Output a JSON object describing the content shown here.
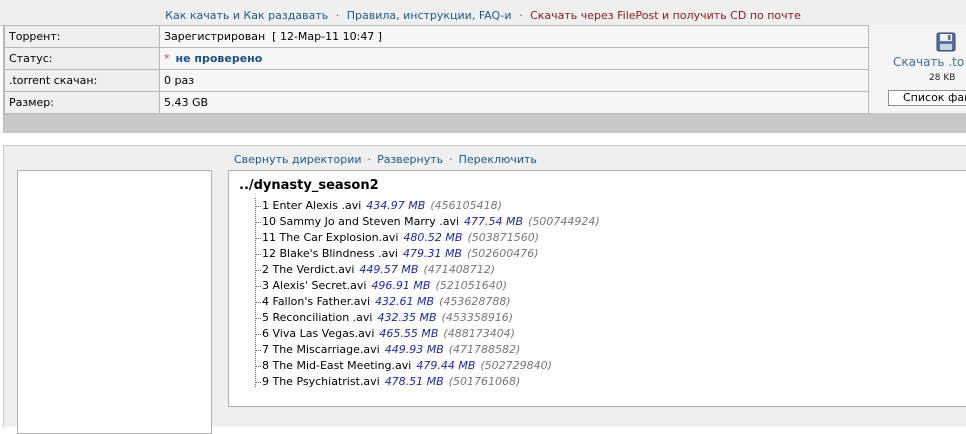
{
  "top_links": {
    "how_to": "Как качать и Как раздавать",
    "rules": "Правила, инструкции, FAQ-и",
    "filepost": "Скачать через FilePost и получить CD по почте",
    "separator": "·"
  },
  "info": {
    "rows": [
      {
        "label": "Торрент:",
        "value": "Зарегистрирован  [ 12-Мар-11 10:47 ]"
      },
      {
        "label": "Статус:",
        "value": "не проверено",
        "marker": "*"
      },
      {
        "label": ".torrent скачан:",
        "value": "0 раз"
      },
      {
        "label": "Размер:",
        "value": "5.43 GB"
      }
    ]
  },
  "download": {
    "icon": "floppy-disk-icon",
    "link_label": "Скачать .to",
    "size": "28 KB",
    "file_list_button": "Список фай"
  },
  "tree_nav": {
    "collapse": "Свернуть директории",
    "expand": "Развернуть",
    "toggle": "Переключить",
    "separator": "·"
  },
  "directory": {
    "name": "../dynasty_season2",
    "files": [
      {
        "name": "1 Enter Alexis .avi",
        "size": "434.97 MB",
        "bytes": "(456105418)"
      },
      {
        "name": "10 Sammy Jo and Steven Marry .avi",
        "size": "477.54 MB",
        "bytes": "(500744924)"
      },
      {
        "name": "11 The Car Explosion.avi",
        "size": "480.52 MB",
        "bytes": "(503871560)"
      },
      {
        "name": "12 Blake's Blindness .avi",
        "size": "479.31 MB",
        "bytes": "(502600476)"
      },
      {
        "name": "2 The Verdict.avi",
        "size": "449.57 MB",
        "bytes": "(471408712)"
      },
      {
        "name": "3 Alexis' Secret.avi",
        "size": "496.91 MB",
        "bytes": "(521051640)"
      },
      {
        "name": "4 Fallon's Father.avi",
        "size": "432.61 MB",
        "bytes": "(453628788)"
      },
      {
        "name": "5 Reconciliation .avi",
        "size": "432.35 MB",
        "bytes": "(453358916)"
      },
      {
        "name": "6 Viva Las Vegas.avi",
        "size": "465.55 MB",
        "bytes": "(488173404)"
      },
      {
        "name": "7 The Miscarriage.avi",
        "size": "449.93 MB",
        "bytes": "(471788582)"
      },
      {
        "name": "8 The Mid-East Meeting.avi",
        "size": "479.44 MB",
        "bytes": "(502729840)"
      },
      {
        "name": "9 The Psychiatrist.avi",
        "size": "478.51 MB",
        "bytes": "(501761068)"
      }
    ]
  }
}
